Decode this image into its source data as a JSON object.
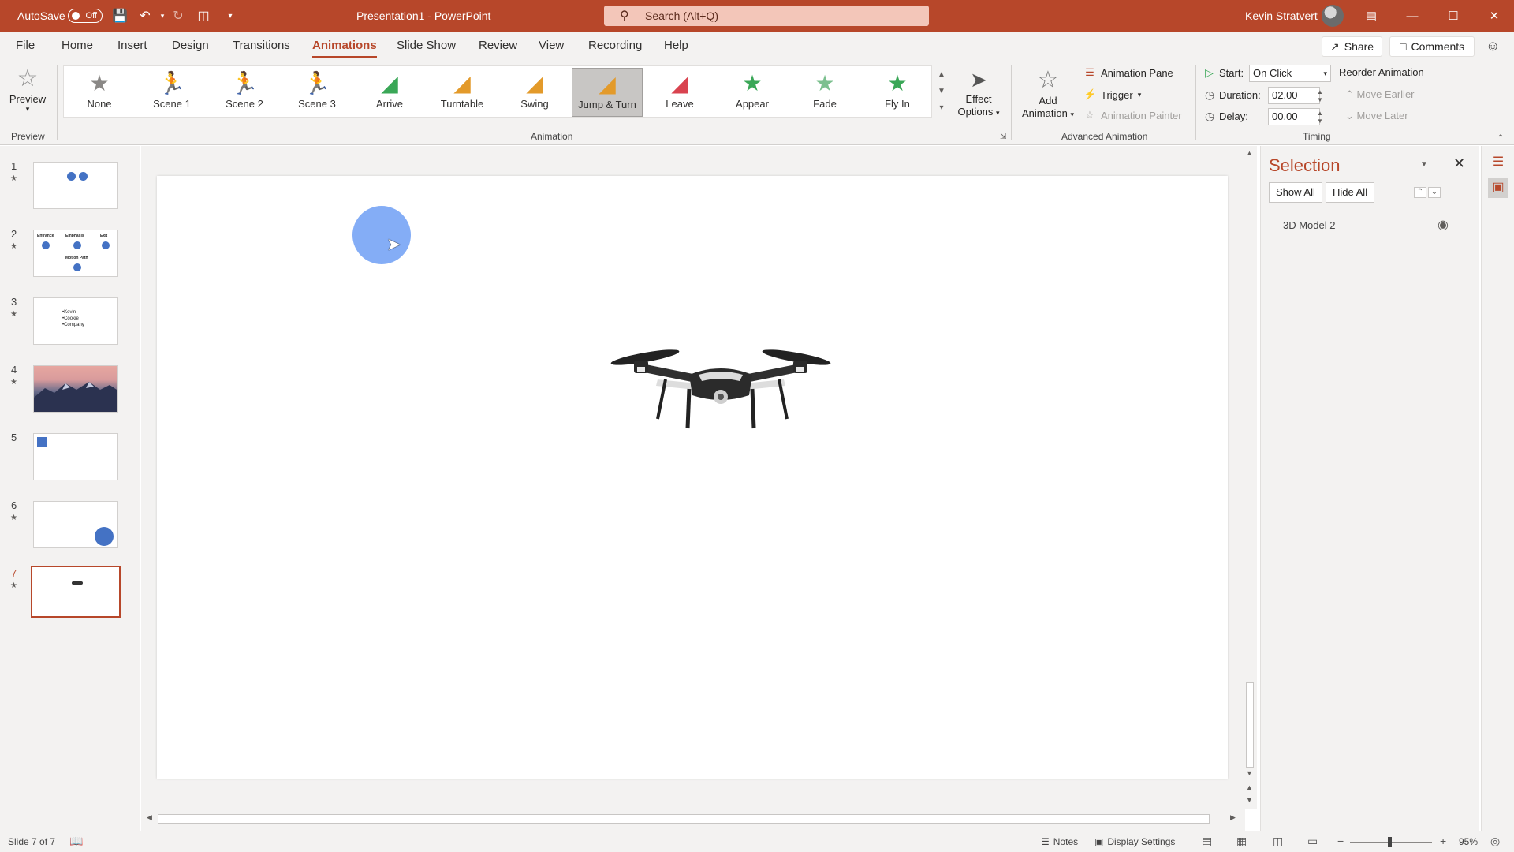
{
  "titlebar": {
    "autosave_label": "AutoSave",
    "autosave_state": "Off",
    "doc_title": "Presentation1  -  PowerPoint",
    "search_placeholder": "Search (Alt+Q)",
    "user_name": "Kevin Stratvert",
    "accent": "#b7472a"
  },
  "menu": {
    "tabs": [
      "File",
      "Home",
      "Insert",
      "Design",
      "Transitions",
      "Animations",
      "Slide Show",
      "Review",
      "View",
      "Recording",
      "Help"
    ],
    "active_tab": "Animations",
    "share": "Share",
    "comments": "Comments"
  },
  "ribbon": {
    "preview": {
      "label": "Preview",
      "group": "Preview"
    },
    "animation_group": "Animation",
    "animations": [
      {
        "label": "None",
        "icon": "star-gray-icon"
      },
      {
        "label": "Scene 1",
        "icon": "scene-figure-icon"
      },
      {
        "label": "Scene 2",
        "icon": "scene-figure-icon"
      },
      {
        "label": "Scene 3",
        "icon": "scene-figure-icon"
      },
      {
        "label": "Arrive",
        "icon": "cube-green-icon"
      },
      {
        "label": "Turntable",
        "icon": "cube-orange-icon"
      },
      {
        "label": "Swing",
        "icon": "cube-orange-icon"
      },
      {
        "label": "Jump & Turn",
        "icon": "cube-orange-icon"
      },
      {
        "label": "Leave",
        "icon": "cube-red-icon"
      },
      {
        "label": "Appear",
        "icon": "star-green-icon"
      },
      {
        "label": "Fade",
        "icon": "star-green-icon"
      },
      {
        "label": "Fly In",
        "icon": "star-green-icon"
      }
    ],
    "selected_animation": "Jump & Turn",
    "effect_options": "Effect Options",
    "add_animation": "Add Animation",
    "advanced_group": "Advanced Animation",
    "animation_pane": "Animation Pane",
    "trigger": "Trigger",
    "animation_painter": "Animation Painter",
    "timing_group": "Timing",
    "start_label": "Start:",
    "start_value": "On Click",
    "duration_label": "Duration:",
    "duration_value": "02.00",
    "delay_label": "Delay:",
    "delay_value": "00.00",
    "reorder": "Reorder Animation",
    "move_earlier": "Move Earlier",
    "move_later": "Move Later"
  },
  "thumbnails": {
    "slides": [
      {
        "num": "1"
      },
      {
        "num": "2",
        "labels": [
          "Entrance",
          "Emphasis",
          "Exit",
          "Motion Path"
        ]
      },
      {
        "num": "3",
        "lines": [
          "•Kevin",
          "•Cookie",
          "•Company"
        ]
      },
      {
        "num": "4"
      },
      {
        "num": "5"
      },
      {
        "num": "6"
      },
      {
        "num": "7"
      }
    ],
    "current": "7"
  },
  "selection_pane": {
    "title": "Selection",
    "show_all": "Show All",
    "hide_all": "Hide All",
    "items": [
      "3D Model 2"
    ]
  },
  "statusbar": {
    "slide_info": "Slide 7 of 7",
    "notes": "Notes",
    "display_settings": "Display Settings",
    "zoom": "95%"
  }
}
